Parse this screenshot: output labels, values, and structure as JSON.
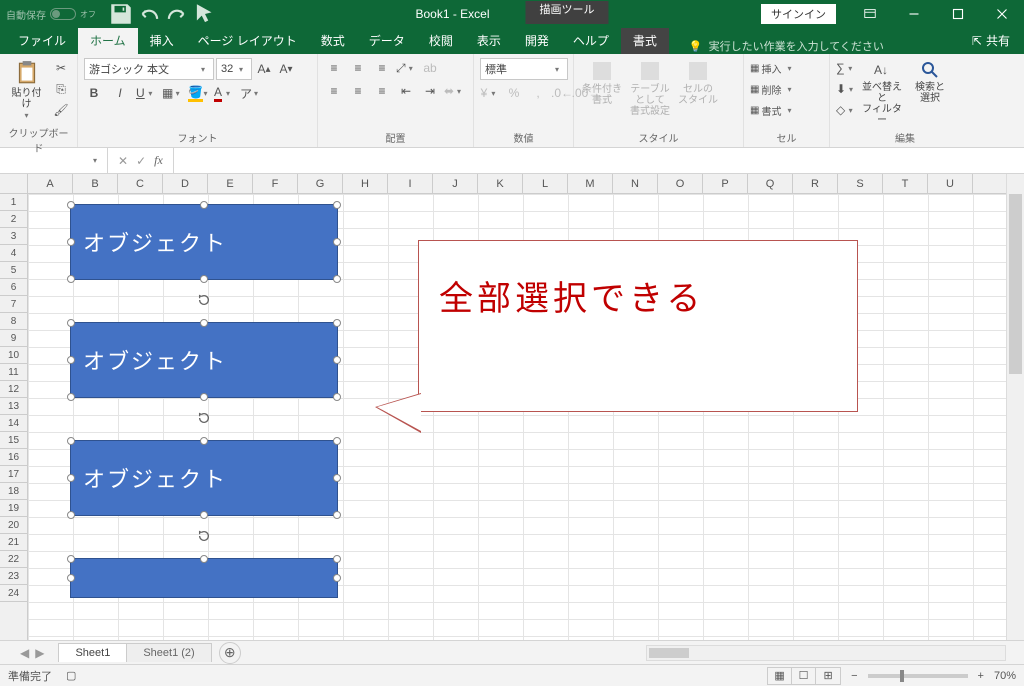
{
  "titlebar": {
    "autosave_label": "自動保存",
    "autosave_state": "オフ",
    "doc_title": "Book1 - Excel",
    "tool_context": "描画ツール",
    "signin": "サインイン"
  },
  "tabs": {
    "file": "ファイル",
    "home": "ホーム",
    "insert": "挿入",
    "layout": "ページ レイアウト",
    "formulas": "数式",
    "data": "データ",
    "review": "校閲",
    "view": "表示",
    "dev": "開発",
    "help": "ヘルプ",
    "format": "書式",
    "tellme": "実行したい作業を入力してください",
    "share": "共有"
  },
  "ribbon": {
    "clipboard": {
      "paste": "貼り付け",
      "label": "クリップボード"
    },
    "font": {
      "name": "游ゴシック 本文",
      "size": "32",
      "label": "フォント"
    },
    "align": {
      "label": "配置"
    },
    "number": {
      "format": "標準",
      "label": "数値"
    },
    "styles": {
      "cond": "条件付き\n書式",
      "table": "テーブルとして\n書式設定",
      "cell": "セルの\nスタイル",
      "label": "スタイル"
    },
    "cells": {
      "insert": "挿入",
      "delete": "削除",
      "fmt": "書式",
      "label": "セル"
    },
    "editing": {
      "sort": "並べ替えと\nフィルター",
      "find": "検索と\n選択",
      "label": "編集"
    }
  },
  "formula_bar": {
    "name": "",
    "fx": "fx"
  },
  "columns": [
    "A",
    "B",
    "C",
    "D",
    "E",
    "F",
    "G",
    "H",
    "I",
    "J",
    "K",
    "L",
    "M",
    "N",
    "O",
    "P",
    "Q",
    "R",
    "S",
    "T",
    "U"
  ],
  "rows": [
    "1",
    "2",
    "3",
    "4",
    "5",
    "6",
    "7",
    "8",
    "9",
    "10",
    "11",
    "12",
    "13",
    "14",
    "15",
    "16",
    "17",
    "18",
    "19",
    "20",
    "21",
    "22",
    "23",
    "24"
  ],
  "shapes": {
    "obj1": "オブジェクト",
    "obj2": "オブジェクト",
    "obj3": "オブジェクト",
    "callout": "全部選択できる"
  },
  "sheets": {
    "s1": "Sheet1",
    "s2": "Sheet1 (2)"
  },
  "status": {
    "ready": "準備完了",
    "zoom": "70%"
  }
}
